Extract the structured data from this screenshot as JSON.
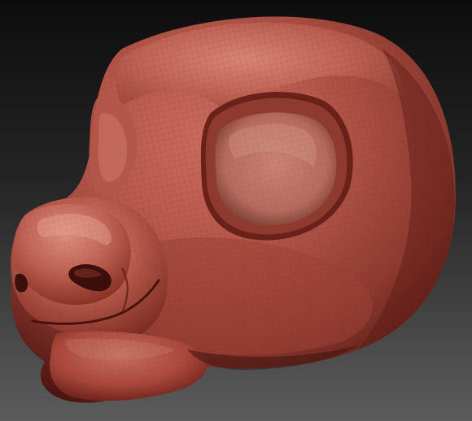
{
  "scene": {
    "subject": "sculpted-head",
    "background": {
      "top": "#0d0d0d",
      "bottom": "#5c5c5c"
    },
    "material": {
      "base": "#a8473b",
      "highlight": "#d98677",
      "mid": "#b5574a",
      "shadow": "#5a1a14",
      "deep_shadow": "#3a0f0b",
      "wire": "#6e241c"
    }
  }
}
